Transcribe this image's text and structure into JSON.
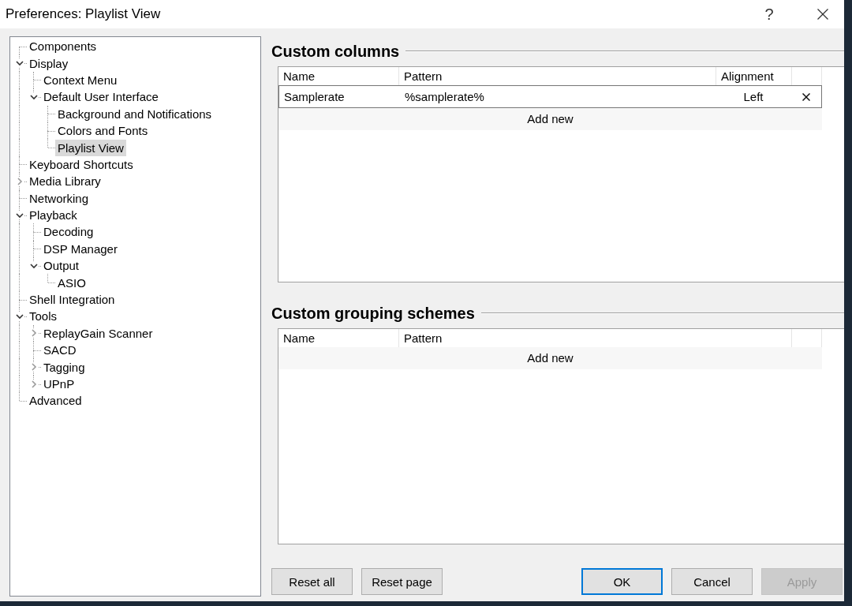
{
  "window": {
    "title": "Preferences: Playlist View",
    "help_button": "?"
  },
  "tree": [
    {
      "label": "Components",
      "selected": false
    },
    {
      "label": "Display",
      "selected": false,
      "expanded": true,
      "children": [
        {
          "label": "Context Menu",
          "selected": false
        },
        {
          "label": "Default User Interface",
          "selected": false,
          "expanded": true,
          "children": [
            {
              "label": "Background and Notifications",
              "selected": false
            },
            {
              "label": "Colors and Fonts",
              "selected": false
            },
            {
              "label": "Playlist View",
              "selected": true
            }
          ]
        }
      ]
    },
    {
      "label": "Keyboard Shortcuts",
      "selected": false
    },
    {
      "label": "Media Library",
      "selected": false,
      "expanded": false
    },
    {
      "label": "Networking",
      "selected": false
    },
    {
      "label": "Playback",
      "selected": false,
      "expanded": true,
      "children": [
        {
          "label": "Decoding",
          "selected": false
        },
        {
          "label": "DSP Manager",
          "selected": false
        },
        {
          "label": "Output",
          "selected": false,
          "expanded": true,
          "children": [
            {
              "label": "ASIO",
              "selected": false
            }
          ]
        }
      ]
    },
    {
      "label": "Shell Integration",
      "selected": false
    },
    {
      "label": "Tools",
      "selected": false,
      "expanded": true,
      "children": [
        {
          "label": "ReplayGain Scanner",
          "selected": false,
          "expanded": false
        },
        {
          "label": "SACD",
          "selected": false
        },
        {
          "label": "Tagging",
          "selected": false,
          "expanded": false
        },
        {
          "label": "UPnP",
          "selected": false,
          "expanded": false
        }
      ]
    },
    {
      "label": "Advanced",
      "selected": false
    }
  ],
  "custom_columns": {
    "title": "Custom columns",
    "columns": [
      "Name",
      "Pattern",
      "Alignment"
    ],
    "rows": [
      {
        "name": "Samplerate",
        "pattern": "%samplerate%",
        "alignment": "Left",
        "selected": true
      }
    ],
    "add_new": "Add new"
  },
  "custom_grouping_schemes": {
    "title": "Custom grouping schemes",
    "columns": [
      "Name",
      "Pattern"
    ],
    "add_new": "Add new"
  },
  "page_buttons": [
    {
      "label": "Reset all",
      "disabled": false,
      "focused": false
    },
    {
      "label": "Reset page",
      "disabled": false,
      "focused": false
    }
  ],
  "dialog_buttons": [
    {
      "label": "OK",
      "disabled": false,
      "focused": true
    },
    {
      "label": "Cancel",
      "disabled": false,
      "focused": false
    },
    {
      "label": "Apply",
      "disabled": true,
      "focused": false
    }
  ]
}
